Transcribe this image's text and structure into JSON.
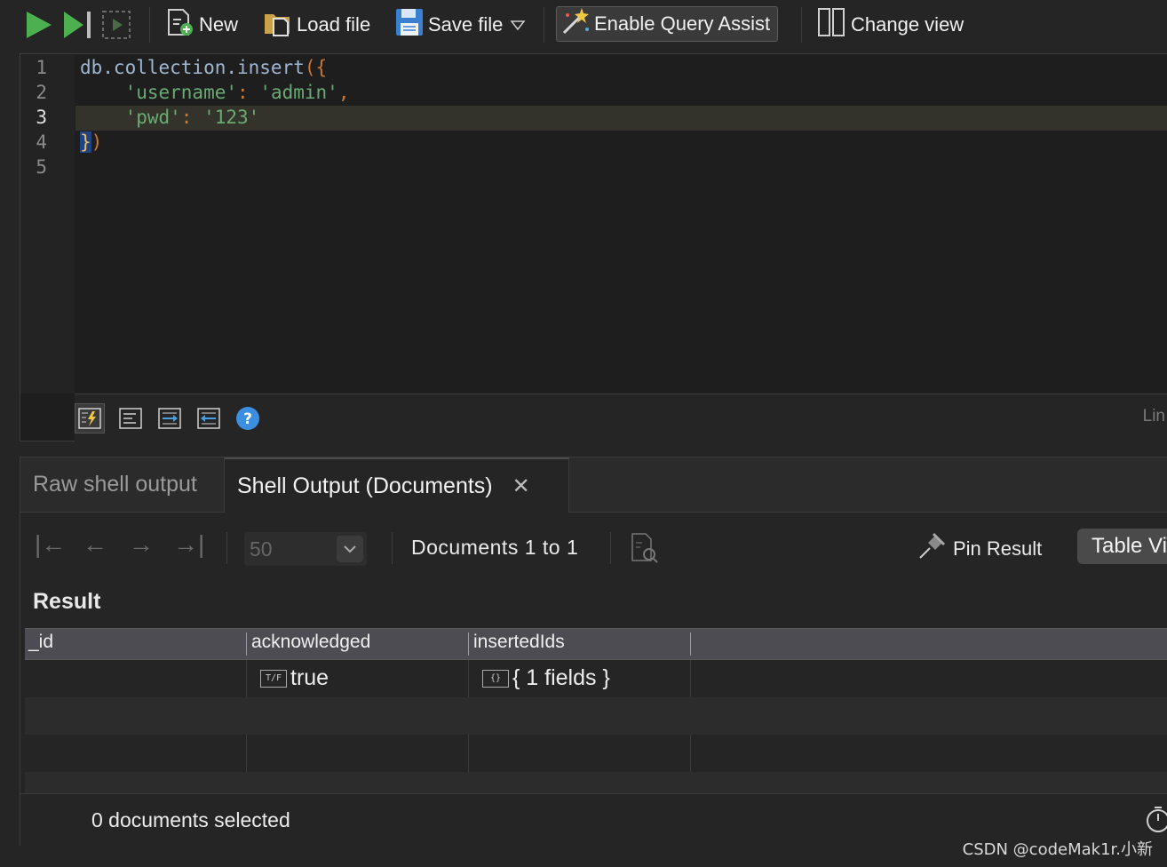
{
  "toolbar": {
    "new_label": "New",
    "load_label": "Load file",
    "save_label": "Save file",
    "query_assist_label": "Enable Query Assist",
    "change_view_label": "Change view"
  },
  "editor": {
    "line_numbers": [
      "1",
      "2",
      "3",
      "4",
      "5"
    ],
    "current_line": 3,
    "lines": {
      "l1_obj": "db.collection.insert",
      "l1_paren": "(",
      "l1_brace": "{",
      "l2_key": "'username'",
      "l2_colon": ": ",
      "l2_val": "'admin'",
      "l2_comma": ",",
      "l3_key": "'pwd'",
      "l3_colon": ": ",
      "l3_val": "'123'",
      "l4_brace": "}",
      "l4_paren": ")"
    },
    "status_fragment": "Lin"
  },
  "results": {
    "tabs": [
      {
        "label": "Raw shell output",
        "active": false
      },
      {
        "label": "Shell Output (Documents)",
        "active": true
      }
    ],
    "page_size": "50",
    "documents_label": "Documents 1 to 1",
    "pin_label": "Pin Result",
    "view_button_label": "Table View",
    "section_title": "Result",
    "columns": [
      "_id",
      "acknowledged",
      "insertedIds"
    ],
    "rows": [
      {
        "_id": "",
        "acknowledged": "true",
        "acknowledged_type": "T/F",
        "insertedIds": "{ 1 fields }",
        "insertedIds_type": "{}"
      }
    ],
    "selection_status": "0 documents selected"
  },
  "watermark": "CSDN @codeMak1r.小新",
  "colors": {
    "background": "#252526",
    "editor_bg": "#1e1e1e",
    "play_green": "#4caf50",
    "string_green": "#6aab73",
    "punct_orange": "#cc7832",
    "help_blue": "#3b8ee0"
  }
}
